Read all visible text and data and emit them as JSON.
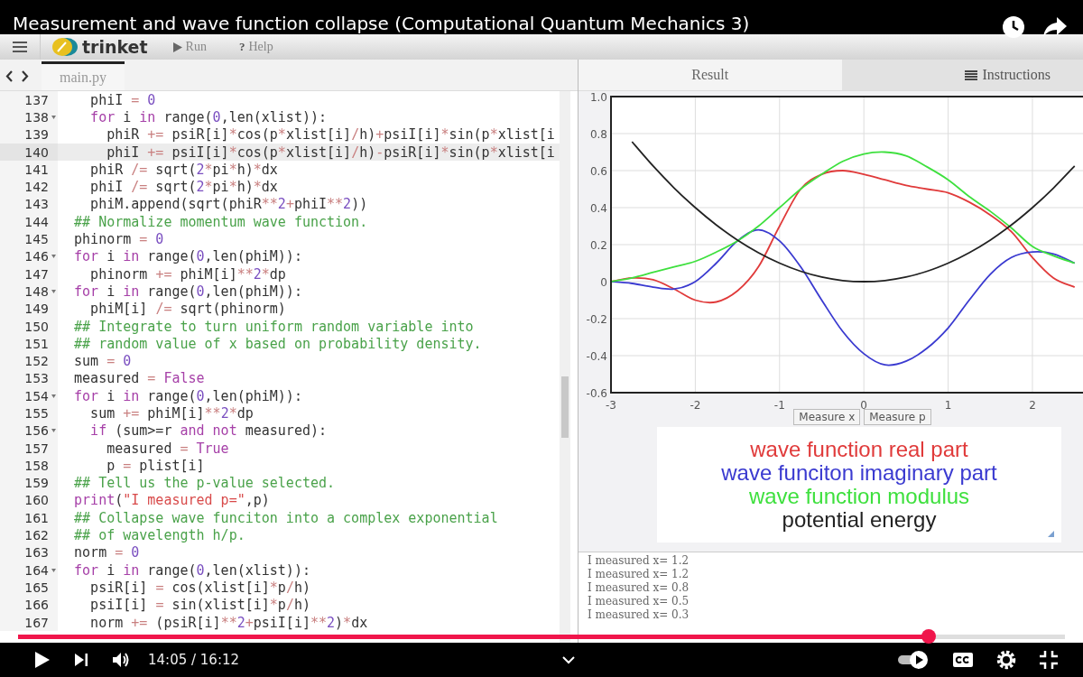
{
  "video": {
    "title": "Measurement and wave function collapse (Computational Quantum Mechanics 3)",
    "time": "14:05 / 16:12",
    "progress": {
      "level": 0.87
    },
    "autoplay": {
      "on": true
    }
  },
  "toolbar": {
    "logo": "trinket",
    "buttons": [
      {
        "kind": "run",
        "label": "Run"
      },
      {
        "kind": "help",
        "glyph": "?",
        "label": "Help"
      }
    ]
  },
  "editor": {
    "tabs": [
      {
        "label": "main.py",
        "selected": true
      }
    ],
    "lines": [
      {
        "number": "137",
        "foldable": false,
        "selected": false,
        "tokens": [
          {
            "kind": "plain",
            "text": "    phiI "
          },
          {
            "kind": "op",
            "text": "="
          },
          {
            "kind": "num",
            "text": " 0"
          }
        ]
      },
      {
        "number": "138",
        "foldable": true,
        "selected": false,
        "tokens": [
          {
            "kind": "kw",
            "text": "    for"
          },
          {
            "kind": "plain",
            "text": " i "
          },
          {
            "kind": "kw",
            "text": "in"
          },
          {
            "kind": "plain",
            "text": " range("
          },
          {
            "kind": "num",
            "text": "0"
          },
          {
            "kind": "plain",
            "text": ",len(xlist)):"
          }
        ]
      },
      {
        "number": "139",
        "foldable": false,
        "selected": false,
        "tokens": [
          {
            "kind": "plain",
            "text": "      phiR "
          },
          {
            "kind": "op",
            "text": "+="
          },
          {
            "kind": "plain",
            "text": " psiR[i]"
          },
          {
            "kind": "op",
            "text": "*"
          },
          {
            "kind": "plain",
            "text": "cos(p"
          },
          {
            "kind": "op",
            "text": "*"
          },
          {
            "kind": "plain",
            "text": "xlist[i]"
          },
          {
            "kind": "op",
            "text": "/"
          },
          {
            "kind": "plain",
            "text": "h)"
          },
          {
            "kind": "op",
            "text": "+"
          },
          {
            "kind": "plain",
            "text": "psiI[i]"
          },
          {
            "kind": "op",
            "text": "*"
          },
          {
            "kind": "plain",
            "text": "sin(p"
          },
          {
            "kind": "op",
            "text": "*"
          },
          {
            "kind": "plain",
            "text": "xlist[i"
          }
        ]
      },
      {
        "number": "140",
        "foldable": false,
        "selected": true,
        "tokens": [
          {
            "kind": "plain",
            "text": "      phiI "
          },
          {
            "kind": "op",
            "text": "+="
          },
          {
            "kind": "plain",
            "text": " psiI[i]"
          },
          {
            "kind": "op",
            "text": "*"
          },
          {
            "kind": "plain",
            "text": "cos(p"
          },
          {
            "kind": "op",
            "text": "*"
          },
          {
            "kind": "plain",
            "text": "xlist[i]"
          },
          {
            "kind": "op",
            "text": "/"
          },
          {
            "kind": "plain",
            "text": "h)"
          },
          {
            "kind": "op",
            "text": "-"
          },
          {
            "kind": "plain",
            "text": "psiR[i]"
          },
          {
            "kind": "op",
            "text": "*"
          },
          {
            "kind": "plain",
            "text": "sin(p"
          },
          {
            "kind": "op",
            "text": "*"
          },
          {
            "kind": "plain",
            "text": "xlist[i"
          }
        ]
      },
      {
        "number": "141",
        "foldable": false,
        "selected": false,
        "tokens": [
          {
            "kind": "plain",
            "text": "    phiR "
          },
          {
            "kind": "op",
            "text": "/="
          },
          {
            "kind": "plain",
            "text": " sqrt("
          },
          {
            "kind": "num",
            "text": "2"
          },
          {
            "kind": "op",
            "text": "*"
          },
          {
            "kind": "plain",
            "text": "pi"
          },
          {
            "kind": "op",
            "text": "*"
          },
          {
            "kind": "plain",
            "text": "h)"
          },
          {
            "kind": "op",
            "text": "*"
          },
          {
            "kind": "plain",
            "text": "dx"
          }
        ]
      },
      {
        "number": "142",
        "foldable": false,
        "selected": false,
        "tokens": [
          {
            "kind": "plain",
            "text": "    phiI "
          },
          {
            "kind": "op",
            "text": "/="
          },
          {
            "kind": "plain",
            "text": " sqrt("
          },
          {
            "kind": "num",
            "text": "2"
          },
          {
            "kind": "op",
            "text": "*"
          },
          {
            "kind": "plain",
            "text": "pi"
          },
          {
            "kind": "op",
            "text": "*"
          },
          {
            "kind": "plain",
            "text": "h)"
          },
          {
            "kind": "op",
            "text": "*"
          },
          {
            "kind": "plain",
            "text": "dx"
          }
        ]
      },
      {
        "number": "143",
        "foldable": false,
        "selected": false,
        "tokens": [
          {
            "kind": "plain",
            "text": "    phiM.append(sqrt(phiR"
          },
          {
            "kind": "op",
            "text": "**"
          },
          {
            "kind": "num",
            "text": "2"
          },
          {
            "kind": "op",
            "text": "+"
          },
          {
            "kind": "plain",
            "text": "phiI"
          },
          {
            "kind": "op",
            "text": "**"
          },
          {
            "kind": "num",
            "text": "2"
          },
          {
            "kind": "plain",
            "text": "))"
          }
        ]
      },
      {
        "number": "144",
        "foldable": false,
        "selected": false,
        "tokens": [
          {
            "kind": "comment",
            "text": "  ## Normalize momentum wave function."
          }
        ]
      },
      {
        "number": "145",
        "foldable": false,
        "selected": false,
        "tokens": [
          {
            "kind": "plain",
            "text": "  phinorm "
          },
          {
            "kind": "op",
            "text": "="
          },
          {
            "kind": "num",
            "text": " 0"
          }
        ]
      },
      {
        "number": "146",
        "foldable": true,
        "selected": false,
        "tokens": [
          {
            "kind": "kw",
            "text": "  for"
          },
          {
            "kind": "plain",
            "text": " i "
          },
          {
            "kind": "kw",
            "text": "in"
          },
          {
            "kind": "plain",
            "text": " range("
          },
          {
            "kind": "num",
            "text": "0"
          },
          {
            "kind": "plain",
            "text": ",len(phiM)):"
          }
        ]
      },
      {
        "number": "147",
        "foldable": false,
        "selected": false,
        "tokens": [
          {
            "kind": "plain",
            "text": "    phinorm "
          },
          {
            "kind": "op",
            "text": "+="
          },
          {
            "kind": "plain",
            "text": " phiM[i]"
          },
          {
            "kind": "op",
            "text": "**"
          },
          {
            "kind": "num",
            "text": "2"
          },
          {
            "kind": "op",
            "text": "*"
          },
          {
            "kind": "plain",
            "text": "dp"
          }
        ]
      },
      {
        "number": "148",
        "foldable": true,
        "selected": false,
        "tokens": [
          {
            "kind": "kw",
            "text": "  for"
          },
          {
            "kind": "plain",
            "text": " i "
          },
          {
            "kind": "kw",
            "text": "in"
          },
          {
            "kind": "plain",
            "text": " range("
          },
          {
            "kind": "num",
            "text": "0"
          },
          {
            "kind": "plain",
            "text": ",len(phiM)):"
          }
        ]
      },
      {
        "number": "149",
        "foldable": false,
        "selected": false,
        "tokens": [
          {
            "kind": "plain",
            "text": "    phiM[i] "
          },
          {
            "kind": "op",
            "text": "/="
          },
          {
            "kind": "plain",
            "text": " sqrt(phinorm)"
          }
        ]
      },
      {
        "number": "150",
        "foldable": false,
        "selected": false,
        "tokens": [
          {
            "kind": "comment",
            "text": "  ## Integrate to turn uniform random variable into"
          }
        ]
      },
      {
        "number": "151",
        "foldable": false,
        "selected": false,
        "tokens": [
          {
            "kind": "comment",
            "text": "  ## random value of x based on probability density."
          }
        ]
      },
      {
        "number": "152",
        "foldable": false,
        "selected": false,
        "tokens": [
          {
            "kind": "plain",
            "text": "  sum "
          },
          {
            "kind": "op",
            "text": "="
          },
          {
            "kind": "num",
            "text": " 0"
          }
        ]
      },
      {
        "number": "153",
        "foldable": false,
        "selected": false,
        "tokens": [
          {
            "kind": "plain",
            "text": "  measured "
          },
          {
            "kind": "op",
            "text": "="
          },
          {
            "kind": "kw",
            "text": " False"
          }
        ]
      },
      {
        "number": "154",
        "foldable": true,
        "selected": false,
        "tokens": [
          {
            "kind": "kw",
            "text": "  for"
          },
          {
            "kind": "plain",
            "text": " i "
          },
          {
            "kind": "kw",
            "text": "in"
          },
          {
            "kind": "plain",
            "text": " range("
          },
          {
            "kind": "num",
            "text": "0"
          },
          {
            "kind": "plain",
            "text": ",len(phiM)):"
          }
        ]
      },
      {
        "number": "155",
        "foldable": false,
        "selected": false,
        "tokens": [
          {
            "kind": "plain",
            "text": "    sum "
          },
          {
            "kind": "op",
            "text": "+="
          },
          {
            "kind": "plain",
            "text": " phiM[i]"
          },
          {
            "kind": "op",
            "text": "**"
          },
          {
            "kind": "num",
            "text": "2"
          },
          {
            "kind": "op",
            "text": "*"
          },
          {
            "kind": "plain",
            "text": "dp"
          }
        ]
      },
      {
        "number": "156",
        "foldable": true,
        "selected": false,
        "tokens": [
          {
            "kind": "kw",
            "text": "    if"
          },
          {
            "kind": "plain",
            "text": " (sum>=r "
          },
          {
            "kind": "kw",
            "text": "and not"
          },
          {
            "kind": "plain",
            "text": " measured):"
          }
        ]
      },
      {
        "number": "157",
        "foldable": false,
        "selected": false,
        "tokens": [
          {
            "kind": "plain",
            "text": "      measured "
          },
          {
            "kind": "op",
            "text": "="
          },
          {
            "kind": "kw",
            "text": " True"
          }
        ]
      },
      {
        "number": "158",
        "foldable": false,
        "selected": false,
        "tokens": [
          {
            "kind": "plain",
            "text": "      p "
          },
          {
            "kind": "op",
            "text": "="
          },
          {
            "kind": "plain",
            "text": " plist[i]"
          }
        ]
      },
      {
        "number": "159",
        "foldable": false,
        "selected": false,
        "tokens": [
          {
            "kind": "comment",
            "text": "  ## Tell us the p-value selected."
          }
        ]
      },
      {
        "number": "160",
        "foldable": false,
        "selected": false,
        "tokens": [
          {
            "kind": "kw",
            "text": "  print"
          },
          {
            "kind": "plain",
            "text": "("
          },
          {
            "kind": "str",
            "text": "\"I measured p=\""
          },
          {
            "kind": "plain",
            "text": ",p)"
          }
        ]
      },
      {
        "number": "161",
        "foldable": false,
        "selected": false,
        "tokens": [
          {
            "kind": "comment",
            "text": "  ## Collapse wave funciton into a complex exponential"
          }
        ]
      },
      {
        "number": "162",
        "foldable": false,
        "selected": false,
        "tokens": [
          {
            "kind": "comment",
            "text": "  ## of wavelength h/p."
          }
        ]
      },
      {
        "number": "163",
        "foldable": false,
        "selected": false,
        "tokens": [
          {
            "kind": "plain",
            "text": "  norm "
          },
          {
            "kind": "op",
            "text": "="
          },
          {
            "kind": "num",
            "text": " 0"
          }
        ]
      },
      {
        "number": "164",
        "foldable": true,
        "selected": false,
        "tokens": [
          {
            "kind": "kw",
            "text": "  for"
          },
          {
            "kind": "plain",
            "text": " i "
          },
          {
            "kind": "kw",
            "text": "in"
          },
          {
            "kind": "plain",
            "text": " range("
          },
          {
            "kind": "num",
            "text": "0"
          },
          {
            "kind": "plain",
            "text": ",len(xlist)):"
          }
        ]
      },
      {
        "number": "165",
        "foldable": false,
        "selected": false,
        "tokens": [
          {
            "kind": "plain",
            "text": "    psiR[i] "
          },
          {
            "kind": "op",
            "text": "="
          },
          {
            "kind": "plain",
            "text": " cos(xlist[i]"
          },
          {
            "kind": "op",
            "text": "*"
          },
          {
            "kind": "plain",
            "text": "p"
          },
          {
            "kind": "op",
            "text": "/"
          },
          {
            "kind": "plain",
            "text": "h)"
          }
        ]
      },
      {
        "number": "166",
        "foldable": false,
        "selected": false,
        "tokens": [
          {
            "kind": "plain",
            "text": "    psiI[i] "
          },
          {
            "kind": "op",
            "text": "="
          },
          {
            "kind": "plain",
            "text": " sin(xlist[i]"
          },
          {
            "kind": "op",
            "text": "*"
          },
          {
            "kind": "plain",
            "text": "p"
          },
          {
            "kind": "op",
            "text": "/"
          },
          {
            "kind": "plain",
            "text": "h)"
          }
        ]
      },
      {
        "number": "167",
        "foldable": false,
        "selected": false,
        "tokens": [
          {
            "kind": "plain",
            "text": "    norm "
          },
          {
            "kind": "op",
            "text": "+="
          },
          {
            "kind": "plain",
            "text": " (psiR[i]"
          },
          {
            "kind": "op",
            "text": "**"
          },
          {
            "kind": "num",
            "text": "2"
          },
          {
            "kind": "op",
            "text": "+"
          },
          {
            "kind": "plain",
            "text": "psiI[i]"
          },
          {
            "kind": "op",
            "text": "**"
          },
          {
            "kind": "num",
            "text": "2"
          },
          {
            "kind": "plain",
            "text": ")"
          },
          {
            "kind": "op",
            "text": "*"
          },
          {
            "kind": "plain",
            "text": "dx"
          }
        ]
      }
    ]
  },
  "result": {
    "tabs": [
      {
        "kind": "result",
        "label": "Result",
        "selected": true
      },
      {
        "kind": "instructions",
        "label": "Instructions",
        "selected": false
      }
    ],
    "chart_data": {
      "type": "line",
      "grid": true,
      "x": [
        -3,
        -2.75,
        -2.5,
        -2.25,
        -2,
        -1.75,
        -1.5,
        -1.25,
        -1,
        -0.75,
        -0.5,
        -0.25,
        0,
        0.25,
        0.5,
        0.75,
        1,
        1.25,
        1.5,
        1.75,
        2,
        2.25,
        2.5
      ],
      "series": [
        {
          "name": "wave function real part",
          "color": "#e03a3a",
          "values": [
            0,
            0.02,
            0.01,
            -0.04,
            -0.1,
            -0.11,
            -0.05,
            0.08,
            0.3,
            0.5,
            0.58,
            0.6,
            0.58,
            0.55,
            0.52,
            0.5,
            0.48,
            0.43,
            0.36,
            0.27,
            0.13,
            0.02,
            -0.03
          ]
        },
        {
          "name": "wave funciton imaginary part",
          "color": "#3a3ad0",
          "values": [
            0,
            -0.01,
            -0.03,
            -0.04,
            0,
            0.1,
            0.22,
            0.28,
            0.22,
            0.08,
            -0.1,
            -0.27,
            -0.39,
            -0.45,
            -0.43,
            -0.36,
            -0.25,
            -0.1,
            0.04,
            0.13,
            0.16,
            0.15,
            0.1
          ]
        },
        {
          "name": "wave function modulus",
          "color": "#3ee03e",
          "values": [
            0,
            0.02,
            0.05,
            0.08,
            0.11,
            0.16,
            0.22,
            0.3,
            0.4,
            0.5,
            0.58,
            0.65,
            0.69,
            0.7,
            0.68,
            0.62,
            0.55,
            0.46,
            0.38,
            0.29,
            0.19,
            0.14,
            0.1
          ]
        },
        {
          "name": "potential energy",
          "color": "#222222",
          "values": [
            null,
            0.756,
            0.625,
            0.506,
            0.4,
            0.306,
            0.225,
            0.156,
            0.1,
            0.056,
            0.025,
            0.006,
            0,
            0.006,
            0.025,
            0.056,
            0.1,
            0.156,
            0.225,
            0.306,
            0.4,
            0.506,
            0.625
          ]
        }
      ],
      "xlim": [
        -3,
        2.6
      ],
      "ylim": [
        -0.6,
        1
      ],
      "xticks": [
        -3,
        -2,
        -1,
        0,
        1,
        2
      ],
      "yticks": [
        {
          "value": 1,
          "label": "1.0"
        },
        0.8,
        0.6,
        0.4,
        0.2,
        0,
        -0.2,
        -0.4,
        -0.6
      ]
    },
    "buttons": [
      "Measure x",
      "Measure p"
    ],
    "console": [
      "I measured x= 1.2",
      "I measured x= 1.2",
      "I measured x= 0.8",
      "I measured x= 0.5",
      "I measured x= 0.3"
    ]
  }
}
